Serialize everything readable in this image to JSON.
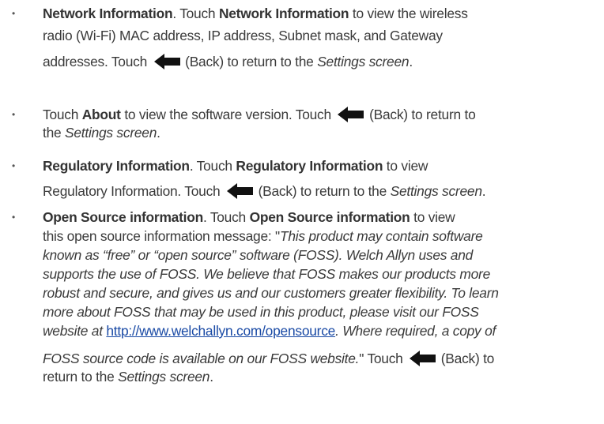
{
  "items": [
    {
      "lines": [
        {
          "t1": "Network Information",
          "t2": ". Touch ",
          "t3": "Network Information",
          "t4": " to view the wireless"
        },
        {
          "t1": "radio (Wi-Fi) MAC address, IP address, Subnet mask, and Gateway"
        },
        {
          "t1": "addresses. Touch ",
          "t2": " (Back) to return to the ",
          "t3": "Settings screen",
          "t4": "."
        }
      ]
    },
    {
      "lines": [
        {
          "t1": "Touch ",
          "t2": "About",
          "t3": " to view the software version. Touch ",
          "t4": " (Back) to return to"
        },
        {
          "t1": "the ",
          "t2": "Settings screen",
          "t3": "."
        }
      ]
    },
    {
      "lines": [
        {
          "t1": "Regulatory Information",
          "t2": ". Touch ",
          "t3": "Regulatory Information",
          "t4": " to view"
        },
        {
          "t1": "Regulatory Information. Touch ",
          "t2": " (Back) to return to the ",
          "t3": "Settings screen",
          "t4": "."
        }
      ]
    },
    {
      "lines": [
        {
          "t1": "Open Source information",
          "t2": ". Touch ",
          "t3": "Open Source information",
          "t4": " to view"
        },
        {
          "t1": "this open source information message: \"",
          "t2": "This product may contain software"
        },
        {
          "t1": "known as “free” or “open source” software (FOSS). Welch Allyn uses and"
        },
        {
          "t1": "supports the use of FOSS. We believe that FOSS makes our products more"
        },
        {
          "t1": "robust and secure, and gives us and our customers greater flexibility. To learn"
        },
        {
          "t1": "more about FOSS that may be used in this product, please visit our FOSS"
        },
        {
          "t1": "website at ",
          "link": "http://www.welchallyn.com/opensource",
          "t2": ". Where required, a copy of"
        },
        {
          "t1": "FOSS source code is available on our FOSS website.",
          "t2": "\" Touch ",
          "t3": " (Back) to"
        },
        {
          "t1": "return to the ",
          "t2": "Settings screen",
          "t3": "."
        }
      ]
    }
  ],
  "bullet_glyph": "•",
  "icon": "back-arrow-icon",
  "icon_color": "#111111",
  "link_color": "#1a4aa5"
}
